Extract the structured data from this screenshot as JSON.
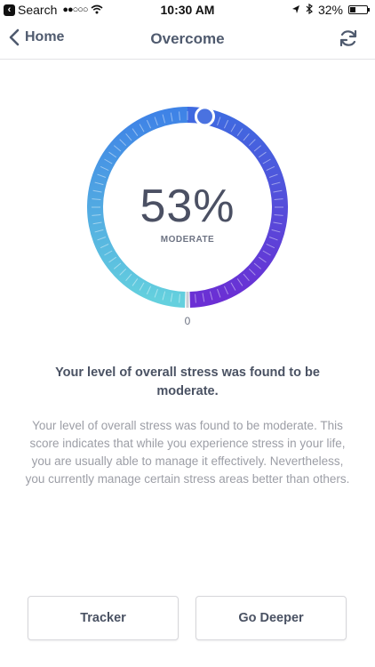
{
  "status_bar": {
    "back_label": "Search",
    "time": "10:30 AM",
    "battery": "32%",
    "battery_level": 0.32
  },
  "nav": {
    "back_label": "Home",
    "title": "Overcome"
  },
  "gauge": {
    "value_text": "53%",
    "value": 0.53,
    "label": "MODERATE",
    "zero_label": "0",
    "colors": {
      "start": "#64d0de",
      "middle": "#3f83e6",
      "end": "#6b2fd4",
      "handle": "#4a72e0"
    }
  },
  "headline": "Your level of overall stress was found to be moderate.",
  "description": "Your level of overall stress was found to be moderate. This score indicates that while you experience stress in your life, you are usually able to  manage it effectively. Nevertheless, you currently manage certain stress areas better than others.",
  "buttons": {
    "tracker": "Tracker",
    "deeper": "Go Deeper"
  }
}
